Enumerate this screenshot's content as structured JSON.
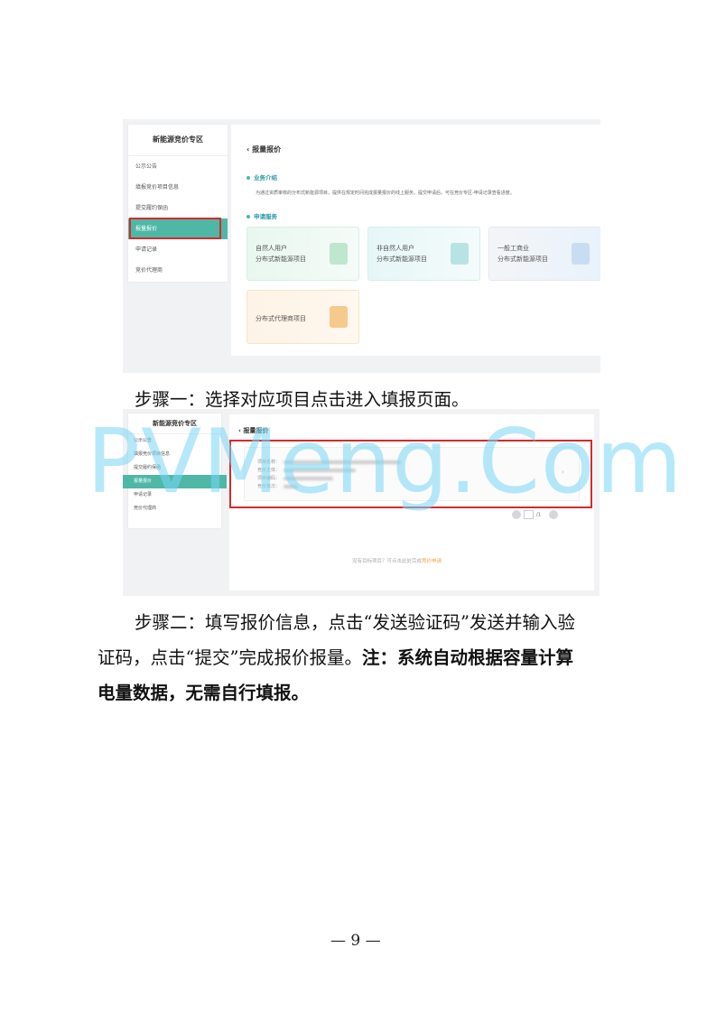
{
  "screenshot1": {
    "sidebar": {
      "title": "新能源竞价专区",
      "items": [
        "公示公告",
        "填报竞价项目信息",
        "提交履约保函",
        "报量报价",
        "申请记录",
        "竞价代理商"
      ],
      "active_index": 3
    },
    "header": {
      "back_icon": "chevron-left-icon",
      "title": "报量报价"
    },
    "intro": {
      "heading": "业务介绍",
      "text": "为通过资质审核的分布式新能源项目，提供在规定时间完成报量报价的线上服务。提交申请后，可在竞价专区-申请记录查看进度。"
    },
    "services": {
      "heading": "申请服务",
      "cards": [
        {
          "line1": "自然人用户",
          "line2": "分布式新能源项目",
          "icon": "person-card-icon"
        },
        {
          "line1": "非自然人用户",
          "line2": "分布式新能源项目",
          "icon": "document-icon"
        },
        {
          "line1": "一般工商业",
          "line2": "分布式新能源项目",
          "icon": "factory-icon"
        },
        {
          "line1": "分布式代理商项目",
          "icon": "folder-icon"
        }
      ]
    }
  },
  "step1_text": "步骤一：选择对应项目点击进入填报页面。",
  "screenshot2": {
    "sidebar": {
      "title": "新能源竞价专区",
      "items": [
        "公示公告",
        "填报竞价项目信息",
        "提交履约保函",
        "报量报价",
        "申请记录",
        "竞价代理商"
      ],
      "active_index": 3
    },
    "header": {
      "back_icon": "chevron-left-icon",
      "title": "报量报价"
    },
    "project_fields": [
      "项目名称：",
      "竞价主体：",
      "项目编码：",
      "竞价批次："
    ],
    "pager": {
      "page": "/1"
    },
    "empty_tip": {
      "text": "没有目标项目？可点击此处完成",
      "link": "竞价申请"
    }
  },
  "watermark": "PVMeng.Com",
  "step2": {
    "line1": "步骤二：填写报价信息，点击“发送验证码”发送并输入验",
    "line2_normal": "证码，点击“提交”完成报价报量。",
    "line2_bold": "注：系统自动根据容量计算",
    "line3_bold": "电量数据，无需自行填报。"
  },
  "page_number": "— 9 —",
  "colors": {
    "accent": "#4fb7a6",
    "highlight": "#d62a2a",
    "watermark": "#78d7f5"
  }
}
